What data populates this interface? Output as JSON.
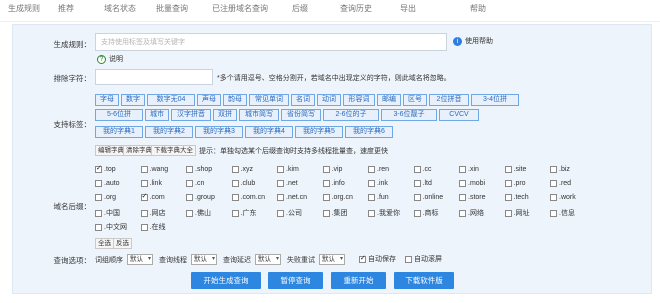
{
  "top_strip": [
    "生成规则",
    "推荐",
    "域名状态",
    "批量查询",
    "已注册域名查询",
    "后缀",
    "查询历史",
    "导出",
    "帮助"
  ],
  "rule": {
    "label": "生成规则：",
    "placeholder": "支持使用标签及填写关键字",
    "help": "使用帮助",
    "tip": "说明"
  },
  "exclude": {
    "label": "排除字符：",
    "value": "",
    "note": "*多个请用逗号、空格分割开，若域名中出现定义的字符，则此域名将忽略。"
  },
  "tags": {
    "label": "支持标签：",
    "row1": [
      "字母",
      "数字",
      "数字无04",
      "声母",
      "韵母",
      "常见单词",
      "名词",
      "动词",
      "形容词",
      "邮编",
      "区号",
      "2位拼音",
      "3-4位拼"
    ],
    "row2": [
      "5-6位拼",
      "城市",
      "汉字拼音",
      "双拼",
      "城市简写",
      "省份简写",
      "2-6位的子",
      "3-6位靓子",
      "CVCV"
    ],
    "row3": [
      "我的字典1",
      "我的字典2",
      "我的字典3",
      "我的字典4",
      "我的字典5",
      "我的字典6"
    ],
    "dict_buttons": [
      "编辑字典",
      "清除字典",
      "下载字典大全"
    ],
    "dict_tip": "提示：单独勾选某个后缀查询时支持多线程批量查，速度更快"
  },
  "suffix": {
    "label": "域名后缀：",
    "rows": [
      [
        ".top",
        ".wang",
        ".shop",
        ".xyz",
        ".kim",
        ".vip",
        ".ren",
        ".cc",
        ".xin",
        ".site",
        ".biz"
      ],
      [
        ".auto",
        ".link",
        ".cn",
        ".club",
        ".net",
        ".info",
        ".ink",
        ".ltd",
        ".mobi",
        ".pro",
        ".red"
      ],
      [
        ".org",
        ".com",
        ".group",
        ".com.cn",
        ".net.cn",
        ".org.cn",
        ".fun",
        ".online",
        ".store",
        ".tech",
        ".work"
      ],
      [
        ".中国",
        ".网店",
        ".佛山",
        ".广东",
        ".公司",
        ".集团",
        ".我爱你",
        ".商标",
        ".网络",
        ".网址",
        ".信息"
      ],
      [
        ".中文网",
        ".在线"
      ]
    ],
    "checked": [
      ".top",
      ".com"
    ],
    "select_all": "全选",
    "invert": "反选"
  },
  "options": {
    "label": "查询选项：",
    "order_label": "词组顺序",
    "order_value": "默认",
    "thread_label": "查询线程",
    "thread_value": "默认",
    "delay_label": "查询延迟",
    "delay_value": "默认",
    "retry_label": "失败重试",
    "retry_value": "默认",
    "autosave": "自动保存",
    "autoscroll": "自动滚屏"
  },
  "actions": [
    "开始生成查询",
    "暂停查询",
    "重新开始",
    "下载软件版"
  ],
  "colors": {
    "accent": "#2d86e0",
    "panel": "#eef4fb",
    "tag_border": "#6ea8e6"
  }
}
